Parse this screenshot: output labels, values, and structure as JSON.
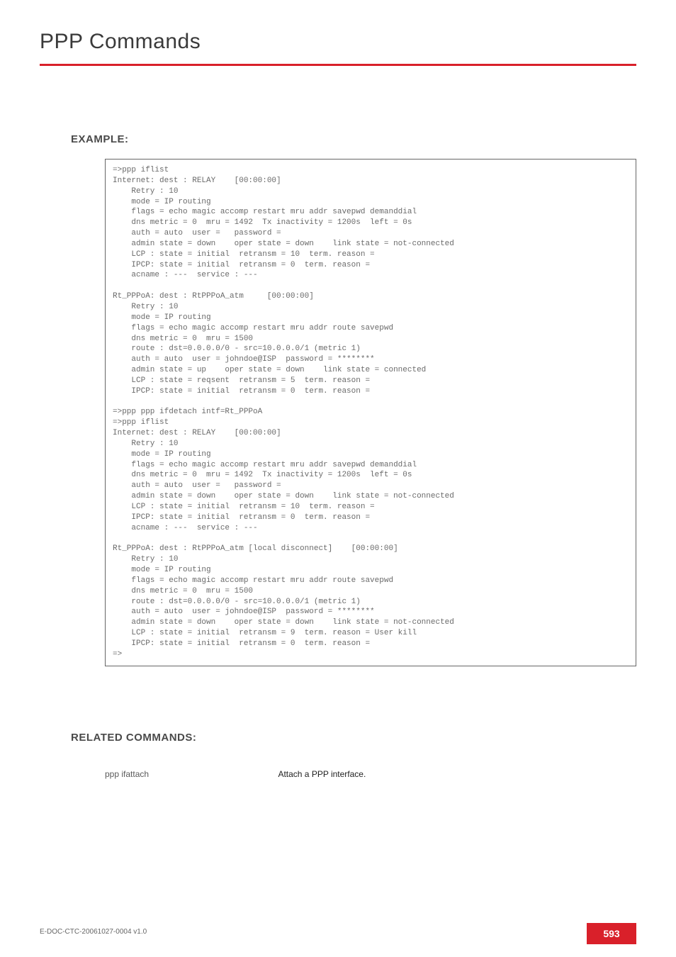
{
  "page": {
    "title": "PPP Commands",
    "exampleHeading": "EXAMPLE:",
    "relatedHeading": "RELATED COMMANDS:",
    "footerDoc": "E-DOC-CTC-20061027-0004 v1.0",
    "pageNumber": "593"
  },
  "codeBlock": "=>ppp iflist\nInternet: dest : RELAY    [00:00:00]\n    Retry : 10\n    mode = IP routing\n    flags = echo magic accomp restart mru addr savepwd demanddial\n    dns metric = 0  mru = 1492  Tx inactivity = 1200s  left = 0s\n    auth = auto  user =   password =\n    admin state = down    oper state = down    link state = not-connected\n    LCP : state = initial  retransm = 10  term. reason =\n    IPCP: state = initial  retransm = 0  term. reason =\n    acname : ---  service : ---\n\nRt_PPPoA: dest : RtPPPoA_atm     [00:00:00]\n    Retry : 10\n    mode = IP routing\n    flags = echo magic accomp restart mru addr route savepwd\n    dns metric = 0  mru = 1500\n    route : dst=0.0.0.0/0 - src=10.0.0.0/1 (metric 1)\n    auth = auto  user = johndoe@ISP  password = ********\n    admin state = up    oper state = down    link state = connected\n    LCP : state = reqsent  retransm = 5  term. reason =\n    IPCP: state = initial  retransm = 0  term. reason =\n\n=>ppp ppp ifdetach intf=Rt_PPPoA\n=>ppp iflist\nInternet: dest : RELAY    [00:00:00]\n    Retry : 10\n    mode = IP routing\n    flags = echo magic accomp restart mru addr savepwd demanddial\n    dns metric = 0  mru = 1492  Tx inactivity = 1200s  left = 0s\n    auth = auto  user =   password =\n    admin state = down    oper state = down    link state = not-connected\n    LCP : state = initial  retransm = 10  term. reason =\n    IPCP: state = initial  retransm = 0  term. reason =\n    acname : ---  service : ---\n\nRt_PPPoA: dest : RtPPPoA_atm [local disconnect]    [00:00:00]\n    Retry : 10\n    mode = IP routing\n    flags = echo magic accomp restart mru addr route savepwd\n    dns metric = 0  mru = 1500\n    route : dst=0.0.0.0/0 - src=10.0.0.0/1 (metric 1)\n    auth = auto  user = johndoe@ISP  password = ********\n    admin state = down    oper state = down    link state = not-connected\n    LCP : state = initial  retransm = 9  term. reason = User kill\n    IPCP: state = initial  retransm = 0  term. reason =\n=>",
  "related": {
    "command": "ppp ifattach",
    "description": "Attach a PPP interface."
  }
}
